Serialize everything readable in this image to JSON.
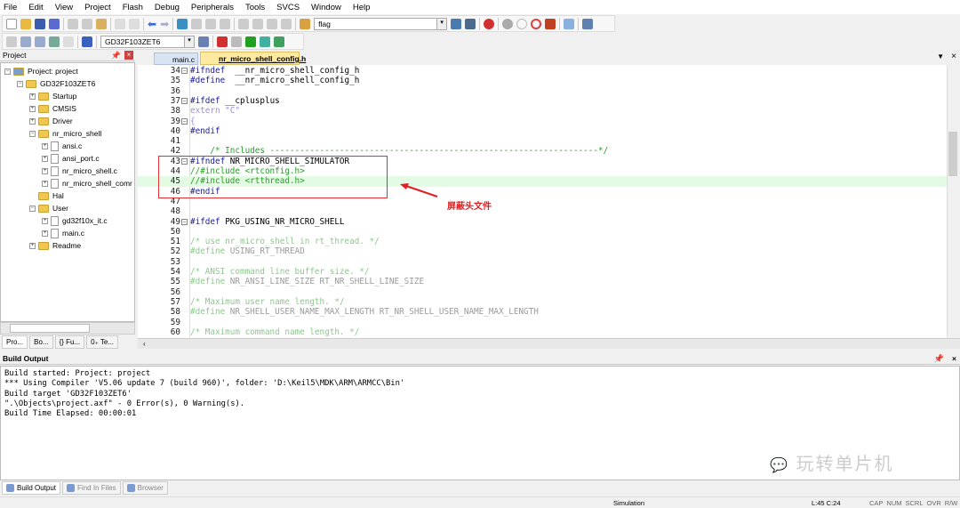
{
  "menu": [
    "File",
    "Edit",
    "View",
    "Project",
    "Flash",
    "Debug",
    "Peripherals",
    "Tools",
    "SVCS",
    "Window",
    "Help"
  ],
  "toolbar": {
    "find_value": "flag",
    "target_value": "GD32F103ZET6"
  },
  "project_panel": {
    "title": "Project",
    "tabs": [
      "Pro...",
      "Bo...",
      "{} Fu...",
      "0₊ Te..."
    ],
    "tree": [
      {
        "label": "Project: project",
        "depth": 0,
        "kind": "root",
        "pm": "-"
      },
      {
        "label": "GD32F103ZET6",
        "depth": 1,
        "kind": "target",
        "pm": "-"
      },
      {
        "label": "Startup",
        "depth": 2,
        "kind": "folder",
        "pm": "+"
      },
      {
        "label": "CMSIS",
        "depth": 2,
        "kind": "folder",
        "pm": "+"
      },
      {
        "label": "Driver",
        "depth": 2,
        "kind": "folder",
        "pm": "+"
      },
      {
        "label": "nr_micro_shell",
        "depth": 2,
        "kind": "folder",
        "pm": "-"
      },
      {
        "label": "ansi.c",
        "depth": 3,
        "kind": "file",
        "pm": "+"
      },
      {
        "label": "ansi_port.c",
        "depth": 3,
        "kind": "file",
        "pm": "+"
      },
      {
        "label": "nr_micro_shell.c",
        "depth": 3,
        "kind": "file",
        "pm": "+"
      },
      {
        "label": "nr_micro_shell_comr",
        "depth": 3,
        "kind": "file",
        "pm": "+"
      },
      {
        "label": "Hal",
        "depth": 2,
        "kind": "folder",
        "pm": ""
      },
      {
        "label": "User",
        "depth": 2,
        "kind": "folder",
        "pm": "-"
      },
      {
        "label": "gd32f10x_it.c",
        "depth": 3,
        "kind": "file",
        "pm": "+"
      },
      {
        "label": "main.c",
        "depth": 3,
        "kind": "file",
        "pm": "+"
      },
      {
        "label": "Readme",
        "depth": 2,
        "kind": "folder",
        "pm": "+"
      }
    ]
  },
  "editor": {
    "tabs": [
      "main.c",
      "nr_micro_shell_config.h"
    ],
    "active_tab": 1,
    "lines": [
      {
        "n": "34",
        "fold": "-",
        "parts": [
          [
            "pp",
            "#ifndef"
          ],
          [
            "",
            "  __nr_micro_shell_config_h"
          ]
        ]
      },
      {
        "n": "35",
        "parts": [
          [
            "pp",
            "#define"
          ],
          [
            "",
            "  __nr_micro_shell_config_h"
          ]
        ]
      },
      {
        "n": "36",
        "parts": []
      },
      {
        "n": "37",
        "fold": "-",
        "parts": [
          [
            "pp",
            "#ifdef"
          ],
          [
            "",
            " __cplusplus"
          ]
        ]
      },
      {
        "n": "38",
        "parts": [
          [
            "ext",
            "extern \"C\""
          ]
        ]
      },
      {
        "n": "39",
        "fold": "-",
        "parts": [
          [
            "ext",
            "{"
          ]
        ]
      },
      {
        "n": "40",
        "parts": [
          [
            "pp",
            "#endif"
          ]
        ]
      },
      {
        "n": "41",
        "parts": []
      },
      {
        "n": "42",
        "parts": [
          [
            "cm",
            "    /* Includes ------------------------------------------------------------------*/"
          ]
        ]
      },
      {
        "n": "43",
        "fold": "-",
        "parts": [
          [
            "pp",
            "#ifndef"
          ],
          [
            "",
            " NR_MICRO_SHELL_SIMULATOR"
          ]
        ]
      },
      {
        "n": "44",
        "parts": [
          [
            "cm",
            "//#include <rtconfig.h>"
          ]
        ]
      },
      {
        "n": "45",
        "hl": true,
        "parts": [
          [
            "cm",
            "//#include <rtthread.h>"
          ]
        ]
      },
      {
        "n": "46",
        "parts": [
          [
            "pp",
            "#endif"
          ]
        ]
      },
      {
        "n": "47",
        "parts": []
      },
      {
        "n": "48",
        "parts": []
      },
      {
        "n": "49",
        "fold": "-",
        "parts": [
          [
            "pp",
            "#ifdef"
          ],
          [
            "",
            " PKG_USING_NR_MICRO_SHELL"
          ]
        ]
      },
      {
        "n": "50",
        "parts": []
      },
      {
        "n": "51",
        "parts": [
          [
            "inactc",
            "/* use nr_micro_shell in rt_thread. */"
          ]
        ]
      },
      {
        "n": "52",
        "parts": [
          [
            "inactc",
            "#define"
          ],
          [
            "inact",
            " USING_RT_THREAD"
          ]
        ]
      },
      {
        "n": "53",
        "parts": []
      },
      {
        "n": "54",
        "parts": [
          [
            "inactc",
            "/* ANSI command line buffer size. */"
          ]
        ]
      },
      {
        "n": "55",
        "parts": [
          [
            "inactc",
            "#define"
          ],
          [
            "inact",
            " NR_ANSI_LINE_SIZE RT_NR_SHELL_LINE_SIZE"
          ]
        ]
      },
      {
        "n": "56",
        "parts": []
      },
      {
        "n": "57",
        "parts": [
          [
            "inactc",
            "/* Maximum user name length. */"
          ]
        ]
      },
      {
        "n": "58",
        "parts": [
          [
            "inactc",
            "#define"
          ],
          [
            "inact",
            " NR_SHELL_USER_NAME_MAX_LENGTH RT_NR_SHELL_USER_NAME_MAX_LENGTH"
          ]
        ]
      },
      {
        "n": "59",
        "parts": []
      },
      {
        "n": "60",
        "parts": [
          [
            "inactc",
            "/* Maximum command name length. */"
          ]
        ]
      }
    ]
  },
  "annotation": {
    "label": "屏蔽头文件",
    "color": "#e02020"
  },
  "build_output": {
    "title": "Build Output",
    "lines": [
      "Build started: Project: project",
      "*** Using Compiler 'V5.06 update 7 (build 960)', folder: 'D:\\Keil5\\MDK\\ARM\\ARMCC\\Bin'",
      "Build target 'GD32F103ZET6'",
      "\".\\Objects\\project.axf\" - 0 Error(s), 0 Warning(s).",
      "Build Time Elapsed:  00:00:01"
    ],
    "tabs": [
      "Build Output",
      "Find In Files",
      "Browser"
    ]
  },
  "watermark": "玩转单片机",
  "status": {
    "mode": "Simulation",
    "position": "L:45 C:24",
    "flags": [
      "CAP",
      "NUM",
      "SCRL",
      "OVR",
      "R/W"
    ]
  }
}
